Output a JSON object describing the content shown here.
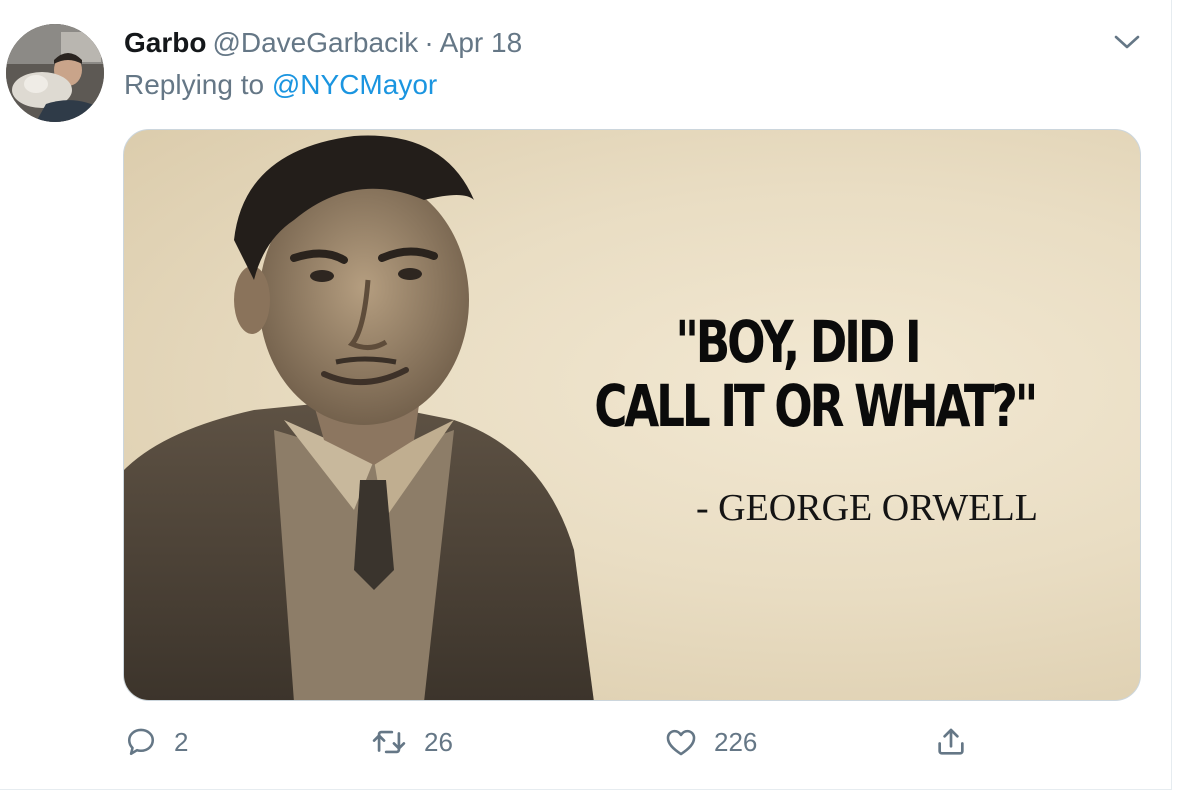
{
  "tweet": {
    "display_name": "Garbo",
    "handle": "@DaveGarbacik",
    "separator": "·",
    "date": "Apr 18",
    "replying_prefix": "Replying to ",
    "replying_to": "@NYCMayor",
    "menu_icon": "chevron-down-icon"
  },
  "media": {
    "quote_line1": "\"BOY, DID I",
    "quote_line2": "CALL IT OR WHAT?\"",
    "attribution": "- GEORGE ORWELL"
  },
  "actions": {
    "replies": "2",
    "retweets": "26",
    "likes": "226",
    "icons": [
      "reply-icon",
      "retweet-icon",
      "like-icon",
      "share-icon"
    ]
  },
  "colors": {
    "name": "#14171a",
    "secondary": "#657786",
    "link": "#1b95e0",
    "border": "#ccd6dd"
  }
}
